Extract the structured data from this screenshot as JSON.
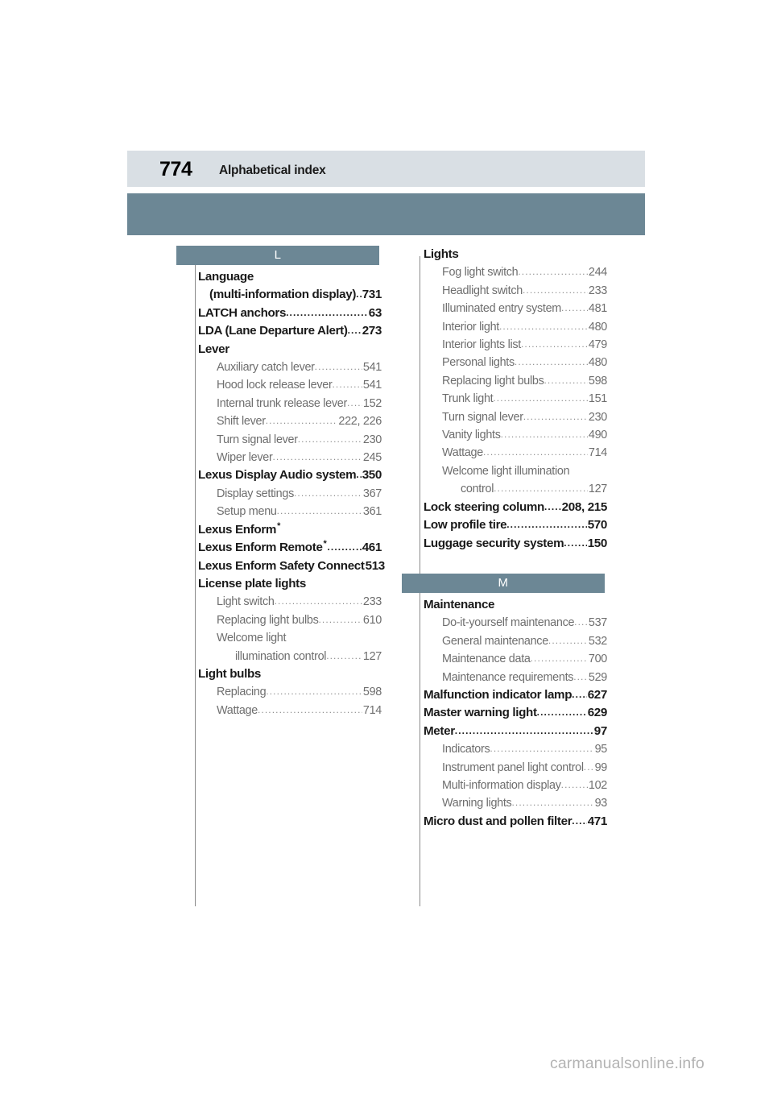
{
  "header": {
    "page_number": "774",
    "title": "Alphabetical index",
    "band_light_color": "#d9dfe4",
    "band_teal_color": "#6c8795"
  },
  "watermark": "carmanualsonline.info",
  "columns": [
    {
      "id": "left",
      "sections": [
        {
          "letter": "L",
          "entries": [
            {
              "level": 0,
              "label": "Language",
              "page": "",
              "dots": false
            },
            {
              "level": 0,
              "label": "(multi-information display)",
              "page": "731",
              "dots": true,
              "cont": true
            },
            {
              "level": 0,
              "label": "LATCH anchors",
              "page": "63",
              "dots": true
            },
            {
              "level": 0,
              "label": "LDA (Lane Departure Alert)",
              "page": "273",
              "dots": true
            },
            {
              "level": 0,
              "label": "Lever",
              "page": "",
              "dots": false
            },
            {
              "level": 1,
              "label": "Auxiliary catch lever",
              "page": "541",
              "dots": true
            },
            {
              "level": 1,
              "label": "Hood lock release lever",
              "page": "541",
              "dots": true
            },
            {
              "level": 1,
              "label": "Internal trunk release lever",
              "page": "152",
              "dots": true
            },
            {
              "level": 1,
              "label": "Shift lever",
              "page": "222, 226",
              "dots": true
            },
            {
              "level": 1,
              "label": "Turn signal lever",
              "page": "230",
              "dots": true
            },
            {
              "level": 1,
              "label": "Wiper lever",
              "page": "245",
              "dots": true
            },
            {
              "level": 0,
              "label": "Lexus Display Audio system",
              "page": "350",
              "dots": true
            },
            {
              "level": 1,
              "label": "Display settings",
              "page": "367",
              "dots": true
            },
            {
              "level": 1,
              "label": "Setup menu",
              "page": "361",
              "dots": true
            },
            {
              "level": 0,
              "label": "Lexus Enform",
              "star": true,
              "page": "",
              "dots": false
            },
            {
              "level": 0,
              "label": "Lexus Enform Remote",
              "star": true,
              "page": "461",
              "dots": true
            },
            {
              "level": 0,
              "label": "Lexus Enform Safety Connect",
              "page": "513",
              "dots": true
            },
            {
              "level": 0,
              "label": "License plate lights",
              "page": "",
              "dots": false
            },
            {
              "level": 1,
              "label": "Light switch",
              "page": "233",
              "dots": true
            },
            {
              "level": 1,
              "label": "Replacing light bulbs",
              "page": "610",
              "dots": true
            },
            {
              "level": 1,
              "label": "Welcome light",
              "page": "",
              "dots": false
            },
            {
              "level": 1,
              "label": "illumination control",
              "page": "127",
              "dots": true,
              "cont": true
            },
            {
              "level": 0,
              "label": "Light bulbs",
              "page": "",
              "dots": false
            },
            {
              "level": 1,
              "label": "Replacing",
              "page": "598",
              "dots": true
            },
            {
              "level": 1,
              "label": "Wattage",
              "page": "714",
              "dots": true
            }
          ]
        }
      ]
    },
    {
      "id": "right",
      "sections": [
        {
          "letter": "",
          "entries": [
            {
              "level": 0,
              "label": "Lights",
              "page": "",
              "dots": false
            },
            {
              "level": 1,
              "label": "Fog light switch",
              "page": "244",
              "dots": true
            },
            {
              "level": 1,
              "label": "Headlight switch",
              "page": "233",
              "dots": true
            },
            {
              "level": 1,
              "label": "Illuminated entry system",
              "page": "481",
              "dots": true
            },
            {
              "level": 1,
              "label": "Interior light",
              "page": "480",
              "dots": true
            },
            {
              "level": 1,
              "label": "Interior lights list",
              "page": "479",
              "dots": true
            },
            {
              "level": 1,
              "label": "Personal lights",
              "page": "480",
              "dots": true
            },
            {
              "level": 1,
              "label": "Replacing light bulbs",
              "page": "598",
              "dots": true
            },
            {
              "level": 1,
              "label": "Trunk light",
              "page": "151",
              "dots": true
            },
            {
              "level": 1,
              "label": "Turn signal lever",
              "page": "230",
              "dots": true
            },
            {
              "level": 1,
              "label": "Vanity lights",
              "page": "490",
              "dots": true
            },
            {
              "level": 1,
              "label": "Wattage",
              "page": "714",
              "dots": true
            },
            {
              "level": 1,
              "label": "Welcome light illumination",
              "page": "",
              "dots": false
            },
            {
              "level": 1,
              "label": "control",
              "page": "127",
              "dots": true,
              "cont": true
            },
            {
              "level": 0,
              "label": "Lock steering column",
              "page": "208, 215",
              "dots": true
            },
            {
              "level": 0,
              "label": "Low profile tire",
              "page": "570",
              "dots": true
            },
            {
              "level": 0,
              "label": "Luggage security system",
              "page": "150",
              "dots": true
            }
          ]
        },
        {
          "letter": "M",
          "entries": [
            {
              "level": 0,
              "label": "Maintenance",
              "page": "",
              "dots": false
            },
            {
              "level": 1,
              "label": "Do-it-yourself maintenance",
              "page": "537",
              "dots": true
            },
            {
              "level": 1,
              "label": "General maintenance",
              "page": "532",
              "dots": true
            },
            {
              "level": 1,
              "label": "Maintenance data",
              "page": "700",
              "dots": true
            },
            {
              "level": 1,
              "label": "Maintenance requirements",
              "page": "529",
              "dots": true
            },
            {
              "level": 0,
              "label": "Malfunction indicator lamp",
              "page": "627",
              "dots": true
            },
            {
              "level": 0,
              "label": "Master warning light",
              "page": "629",
              "dots": true
            },
            {
              "level": 0,
              "label": "Meter",
              "page": "97",
              "dots": true
            },
            {
              "level": 1,
              "label": "Indicators",
              "page": "95",
              "dots": true
            },
            {
              "level": 1,
              "label": "Instrument panel light control",
              "page": "99",
              "dots": true
            },
            {
              "level": 1,
              "label": "Multi-information display",
              "page": "102",
              "dots": true
            },
            {
              "level": 1,
              "label": "Warning lights",
              "page": "93",
              "dots": true
            },
            {
              "level": 0,
              "label": "Micro dust and pollen filter",
              "page": "471",
              "dots": true
            }
          ]
        }
      ]
    }
  ]
}
